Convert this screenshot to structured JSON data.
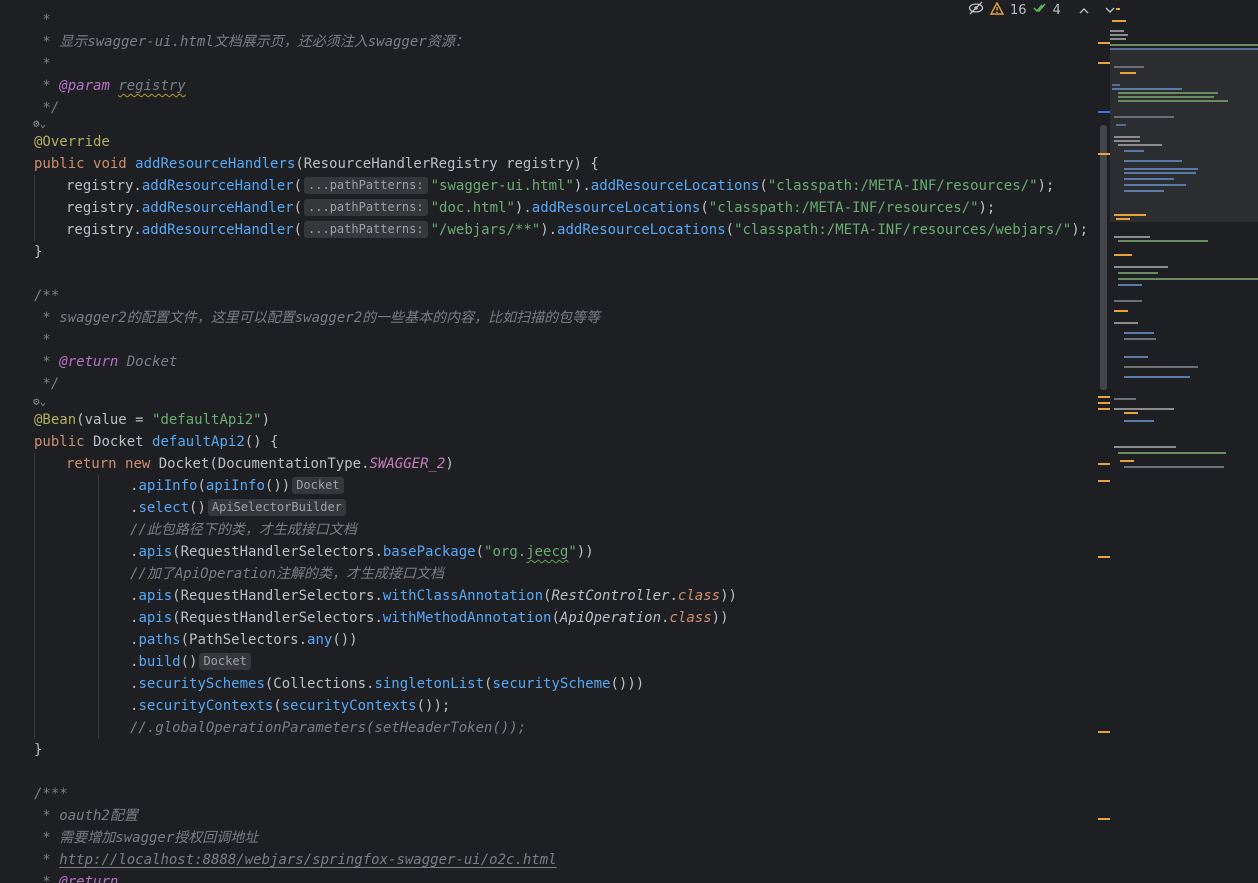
{
  "inspections": {
    "warnings_count": "16",
    "ok_count": "4",
    "colors": {
      "warning": "#e8a33d",
      "ok": "#5fb865"
    },
    "icons": [
      "eye-slash-icon",
      "warning-triangle-icon",
      "double-check-icon",
      "chevron-up-icon",
      "chevron-down-icon"
    ]
  },
  "hints": {
    "path_patterns": "...pathPatterns:",
    "docket": "Docket",
    "api_selector_builder": "ApiSelectorBuilder"
  },
  "code": {
    "l01_star": " *",
    "l02_comment": " * 显示swagger-ui.html文档展示页，还必须注入swagger资源：",
    "l03_star": " *",
    "l04_param_tag": "@param",
    "l04_param_name": "registry",
    "l05_end": " */",
    "l06_override": "@Override",
    "l07_public": "public",
    "l07_void": "void",
    "l07_method": "addResourceHandlers",
    "l07_type": "ResourceHandlerRegistry",
    "l07_param": "registry",
    "l08_str1": "\"swagger-ui.html\"",
    "l08_loc": "\"classpath:/META-INF/resources/\"",
    "l09_str1": "\"doc.html\"",
    "l09_loc": "\"classpath:/META-INF/resources/\"",
    "l10_str1": "\"/webjars/**\"",
    "l10_loc": "\"classpath:/META-INF/resources/webjars/\"",
    "l11_close": "}",
    "l13_open": "/**",
    "l14_comment": " * swagger2的配置文件，这里可以配置swagger2的一些基本的内容，比如扫描的包等等",
    "l15_star": " *",
    "l16_return_tag": "@return",
    "l16_return_type": "Docket",
    "l17_end": " */",
    "l18_bean": "@Bean",
    "l18_value_str": "\"defaultApi2\"",
    "l19_public": "public",
    "l19_type": "Docket",
    "l19_method": "defaultApi2",
    "l20_return": "return",
    "l20_new": "new",
    "l20_docket": "Docket",
    "l20_doctype": "DocumentationType",
    "l20_const": "SWAGGER_2",
    "l23_comment": "//此包路径下的类，才生成接口文档",
    "l24_pkg_pre": "\"org.",
    "l24_pkg_mid": "jeecg",
    "l24_pkg_post": "\"",
    "l25_comment": "//加了ApiOperation注解的类，才生成接口文档",
    "l26_ann": "RestController",
    "l27_ann": "ApiOperation",
    "l33_comment": "//.globalOperationParameters(setHeaderToken());",
    "l34_close": "}",
    "l36_open": "/***",
    "l37_comment": " * oauth2配置",
    "l38_comment": " * 需要增加swagger授权回调地址",
    "l39_prefix": " * ",
    "l39_link": "http://localhost:8888/webjars/springfox-swagger-ui/o2c.html",
    "l40_prefix": " * ",
    "l40_return_tag": "@return"
  }
}
